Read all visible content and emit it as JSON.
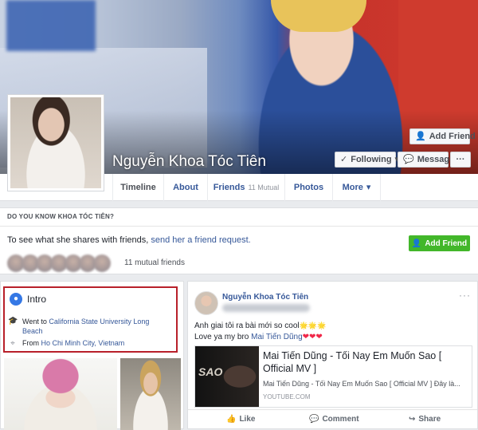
{
  "profile": {
    "name": "Nguyễn Khoa Tóc Tiên"
  },
  "cover_buttons": {
    "add_friend": "Add Friend",
    "following": "Following",
    "message": "Message",
    "more": "···"
  },
  "tabs": [
    {
      "label": "Timeline"
    },
    {
      "label": "About"
    },
    {
      "label": "Friends",
      "sub": "11 Mutual"
    },
    {
      "label": "Photos"
    },
    {
      "label": "More"
    }
  ],
  "do_you_know": {
    "title": "DO YOU KNOW KHOA TÓC TIÊN?",
    "text_prefix": "To see what she shares with friends, ",
    "text_link": "send her a friend request.",
    "button": "Add Friend",
    "mutual": "11 mutual friends"
  },
  "intro": {
    "title": "Intro",
    "went_prefix": "Went to ",
    "went_value": "California State University Long Beach",
    "from_prefix": "From ",
    "from_value": "Ho Chi Minh City, Vietnam"
  },
  "post": {
    "author": "Nguyễn Khoa Tóc Tiên",
    "more": "···",
    "line1": "Anh giai tôi ra bài mới so cool",
    "line1_emoji": "🌟🌟🌟",
    "line2_prefix": "Love ya my bro ",
    "line2_link": "Mai Tiến Dũng",
    "line2_hearts": "❤❤❤",
    "link": {
      "thumb_text": "SAO",
      "title": "Mai Tiến Dũng - Tối Nay Em Muốn Sao [ Official MV ]",
      "description": "Mai Tiến Dũng - Tối Nay Em Muốn Sao [ Official MV ] Đây là...",
      "domain": "YOUTUBE.COM"
    },
    "actions": {
      "like": "Like",
      "comment": "Comment",
      "share": "Share"
    }
  },
  "colors": {
    "link": "#365899",
    "add_friend_green": "#42b72a",
    "highlight_red": "#b8202a",
    "background": "#e9ebee"
  },
  "icons": [
    "add-friend-icon",
    "check-icon",
    "chevron-down-icon",
    "messenger-icon",
    "globe-icon",
    "graduation-cap-icon",
    "location-pin-icon",
    "like-icon",
    "comment-icon",
    "share-icon"
  ]
}
